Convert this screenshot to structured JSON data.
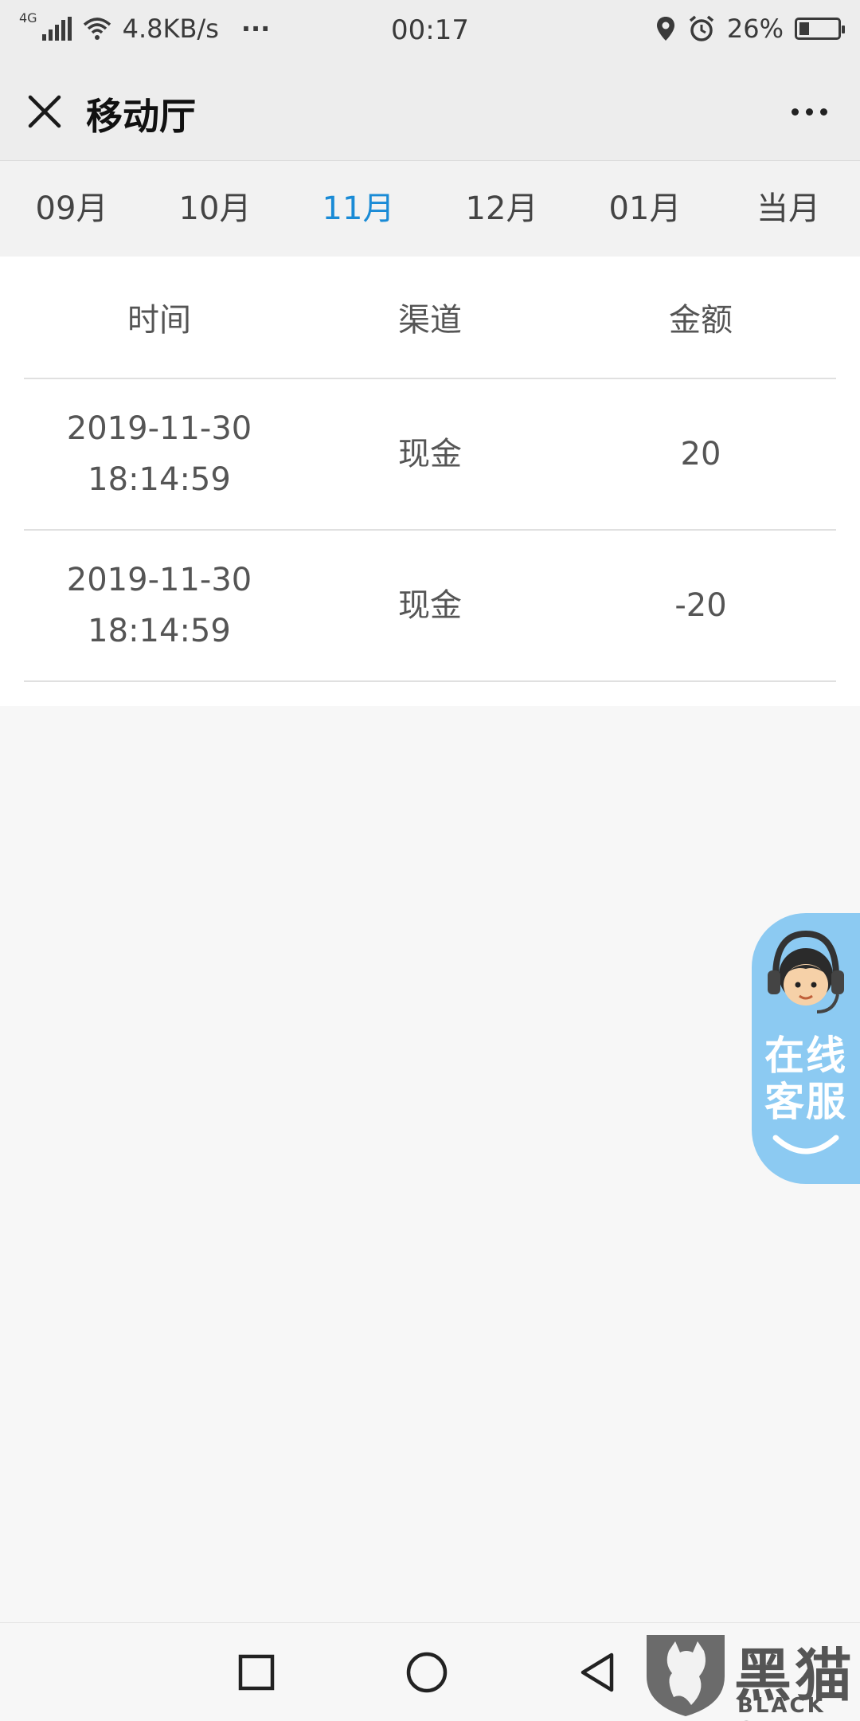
{
  "status_bar": {
    "network_type": "4G",
    "speed": "4.8KB/s",
    "more": "···",
    "time": "00:17",
    "battery": "26%",
    "battery_level": 0.26
  },
  "header": {
    "title": "移动厅"
  },
  "tabs": [
    {
      "label": "09月",
      "active": false
    },
    {
      "label": "10月",
      "active": false
    },
    {
      "label": "11月",
      "active": true
    },
    {
      "label": "12月",
      "active": false
    },
    {
      "label": "01月",
      "active": false
    },
    {
      "label": "当月",
      "active": false
    }
  ],
  "table": {
    "headers": [
      "时间",
      "渠道",
      "金额"
    ],
    "rows": [
      {
        "date": "2019-11-30",
        "time": "18:14:59",
        "channel": "现金",
        "amount": "20"
      },
      {
        "date": "2019-11-30",
        "time": "18:14:59",
        "channel": "现金",
        "amount": "-20"
      }
    ]
  },
  "customer_service": {
    "line1": "在线",
    "line2": "客服"
  },
  "watermark": {
    "title": "黑猫",
    "subtitle": "BLACK CAT"
  },
  "colors": {
    "active_tab": "#1a8bd6",
    "cs_bubble": "#8ccaf2"
  }
}
